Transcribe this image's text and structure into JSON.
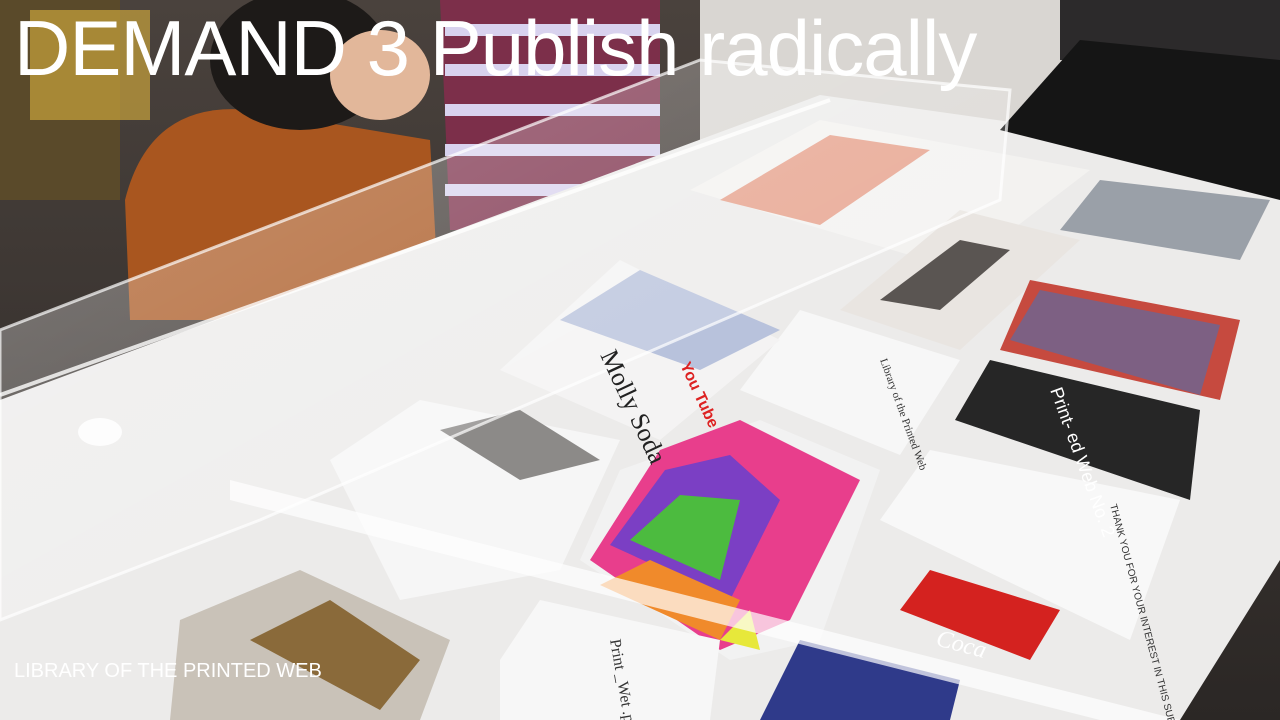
{
  "slide": {
    "title": "DEMAND 3 Publish radically",
    "caption": "LIBRARY OF THE PRINTED WEB"
  },
  "photo": {
    "book_texts": {
      "molly_soda": "Molly Soda",
      "you_tube": "You Tube",
      "library_spine": "Library of the Printed Web",
      "printed_web_2": "Print- ed Web No. 2",
      "thank_you": "THANK YOU FOR YOUR INTEREST IN THIS SUBJECT.",
      "print_wet": "Print _Wet .pd",
      "coca": "Coca"
    }
  }
}
